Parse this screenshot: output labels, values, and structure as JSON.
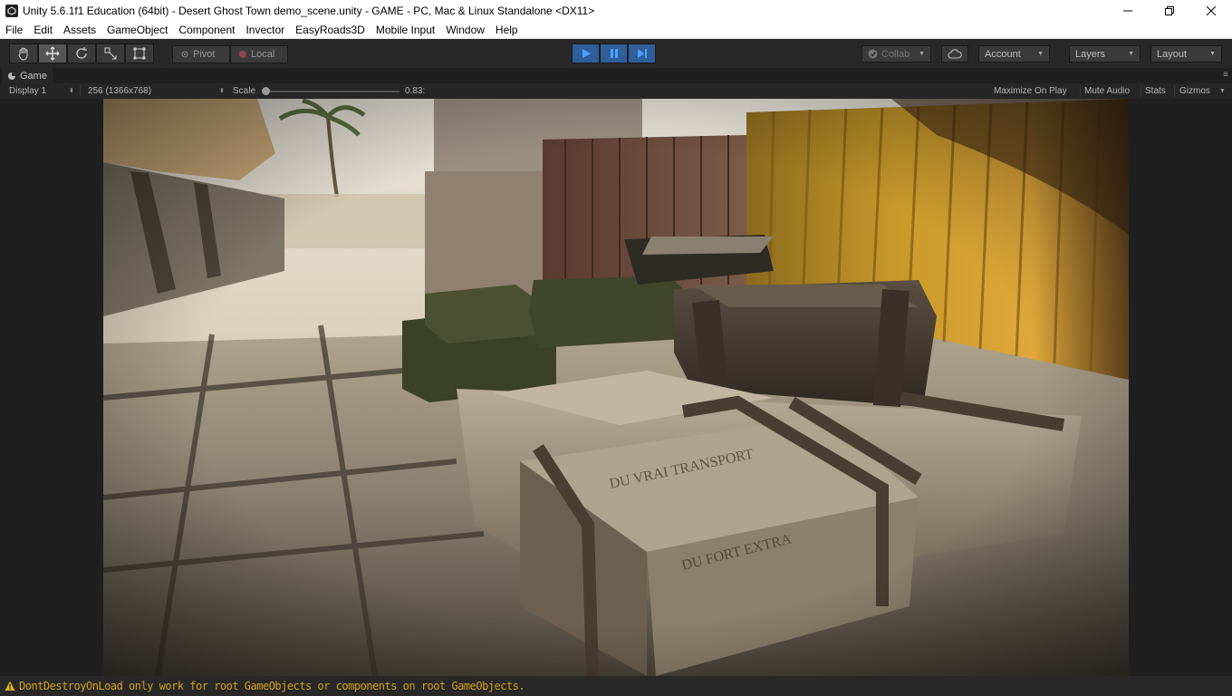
{
  "window": {
    "title": "Unity 5.6.1f1 Education (64bit) - Desert Ghost Town demo_scene.unity - GAME - PC, Mac & Linux Standalone <DX11>"
  },
  "menu": [
    "File",
    "Edit",
    "Assets",
    "GameObject",
    "Component",
    "Invector",
    "EasyRoads3D",
    "Mobile Input",
    "Window",
    "Help"
  ],
  "toolbar": {
    "pivot_label": "Pivot",
    "local_label": "Local",
    "collab_label": "Collab",
    "account_label": "Account",
    "layers_label": "Layers",
    "layout_label": "Layout"
  },
  "game_view": {
    "tab_label": "Game",
    "display": "Display 1",
    "resolution": "256 (1366x768)",
    "scale_label": "Scale",
    "scale_value": "0.83:",
    "maximize_on_play": "Maximize On Play",
    "mute_audio": "Mute Audio",
    "stats": "Stats",
    "gizmos": "Gizmos"
  },
  "console": {
    "message": "DontDestroyOnLoad only work for root GameObjects or components on root GameObjects."
  },
  "colors": {
    "play_active": "#2f5e9a",
    "warning_text": "#d4a017",
    "editor_bg": "#282828"
  },
  "icons": [
    "unity-logo-icon",
    "hand-tool-icon",
    "move-tool-icon",
    "rotate-tool-icon",
    "scale-tool-icon",
    "rect-tool-icon",
    "play-icon",
    "pause-icon",
    "step-icon",
    "cloud-icon",
    "warning-icon"
  ]
}
